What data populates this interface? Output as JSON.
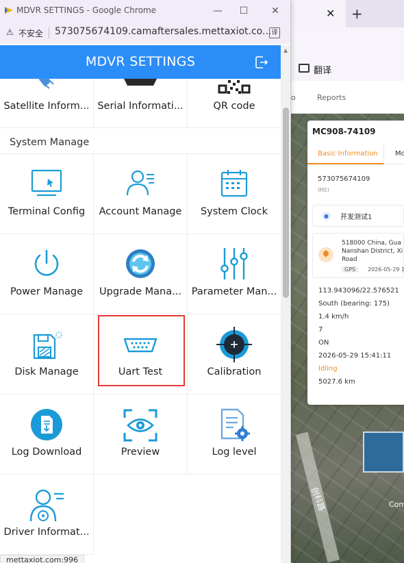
{
  "browser_bg": {
    "tab_close": "✕",
    "new_tab": "+",
    "bookmark_label": "翻译",
    "nav_partial": "o",
    "nav_reports": "Reports"
  },
  "vehicle_card": {
    "title": "MC908-74109",
    "tab_basic": "Basic Information",
    "tab_more": "Mo",
    "imei_value": "573075674109",
    "imei_label": "IMEI",
    "user_name": "开发测试1",
    "address_line1": "518000 China, Gua",
    "address_line2": "Nanshan District, Xi",
    "address_line3": "Road",
    "gps_badge": "GPS",
    "gps_time": "2026-05-29 1",
    "coords": "113.943096/22.576521",
    "direction": "South (bearing: 175)",
    "speed": "1.4 km/h",
    "satellites": "7",
    "acc": "ON",
    "update_time": "2026-05-29 15:41:11",
    "status": "Idling",
    "mileage": "5027.6 km"
  },
  "map": {
    "road_label": "创科路",
    "corner_label": "Com"
  },
  "window": {
    "title": "MDVR SETTINGS - Google Chrome",
    "minimize": "—",
    "maximize": "☐",
    "close": "✕",
    "warn_icon": "⚠",
    "insecure_label": "不安全",
    "url": "573075674109.camaftersales.mettaxiot.co...",
    "translate_icon": "译"
  },
  "app": {
    "title": "MDVR SETTINGS",
    "accent": "#2b8df7",
    "top_row": [
      {
        "label": "Satellite Inform...",
        "icon": "satellite-icon"
      },
      {
        "label": "Serial Informati...",
        "icon": "serial-port-icon"
      },
      {
        "label": "QR code",
        "icon": "qr-code-icon"
      }
    ],
    "section_title": "System Manage",
    "grid": [
      {
        "label": "Terminal Config",
        "icon": "monitor-icon"
      },
      {
        "label": "Account Manage",
        "icon": "user-list-icon"
      },
      {
        "label": "System Clock",
        "icon": "calendar-icon"
      },
      {
        "label": "Power Manage",
        "icon": "power-icon"
      },
      {
        "label": "Upgrade Mana...",
        "icon": "refresh-icon"
      },
      {
        "label": "Parameter Man...",
        "icon": "sliders-icon"
      },
      {
        "label": "Disk Manage",
        "icon": "floppy-disk-icon"
      },
      {
        "label": "Uart Test",
        "icon": "serial-connector-icon"
      },
      {
        "label": "Calibration",
        "icon": "crosshair-icon"
      },
      {
        "label": "Log Download",
        "icon": "document-download-icon"
      },
      {
        "label": "Preview",
        "icon": "eye-icon"
      },
      {
        "label": "Log level",
        "icon": "document-gear-icon"
      },
      {
        "label": "Driver Informat...",
        "icon": "driver-icon"
      }
    ],
    "status_url": "mettaxiot.com:996"
  }
}
